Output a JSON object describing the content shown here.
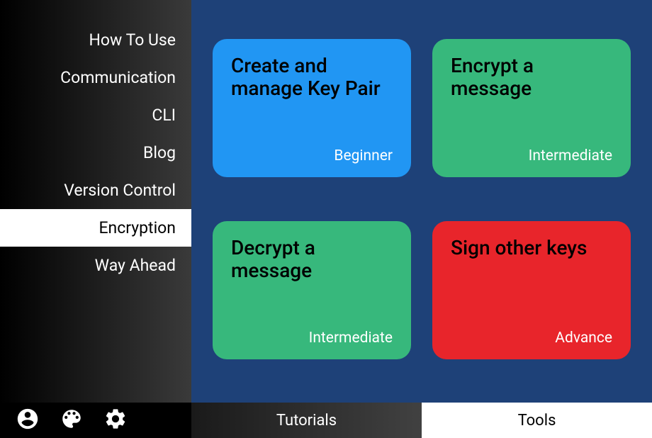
{
  "sidebar": {
    "items": [
      {
        "label": "How To Use"
      },
      {
        "label": "Communication"
      },
      {
        "label": "CLI"
      },
      {
        "label": "Blog"
      },
      {
        "label": "Version Control"
      },
      {
        "label": "Encryption"
      },
      {
        "label": "Way Ahead"
      }
    ]
  },
  "cards": [
    {
      "title": "Create and manage Key Pair",
      "level": "Beginner",
      "color": "blue"
    },
    {
      "title": "Encrypt a message",
      "level": "Intermediate",
      "color": "green"
    },
    {
      "title": "Decrypt a message",
      "level": "Intermediate",
      "color": "green"
    },
    {
      "title": "Sign other keys",
      "level": "Advance",
      "color": "red"
    }
  ],
  "bottomTabs": {
    "tutorials": "Tutorials",
    "tools": "Tools"
  }
}
